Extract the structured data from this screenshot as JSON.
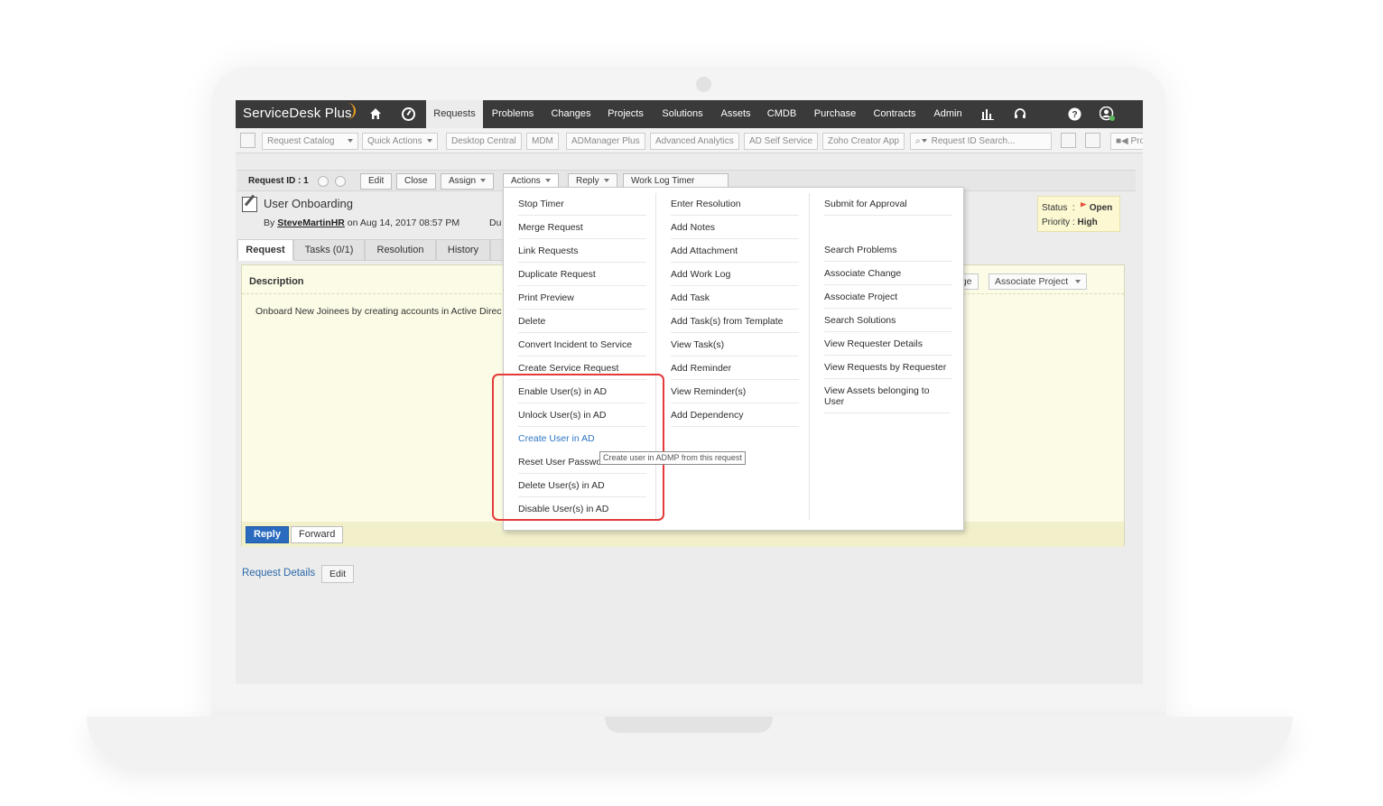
{
  "nav": {
    "logo": "ServiceDesk Plus",
    "tabs": [
      "Requests",
      "Problems",
      "Changes",
      "Projects",
      "Solutions",
      "Assets",
      "CMDB",
      "Purchase",
      "Contracts",
      "Admin"
    ],
    "icons": [
      "home-icon",
      "dashboard-icon",
      "reports-icon",
      "headset-icon",
      "help-icon",
      "user-profile-icon"
    ]
  },
  "toolbar": {
    "request_catalog": "Request Catalog",
    "quick_actions": "Quick Actions",
    "desktop_central": "Desktop Central",
    "mdm": "MDM",
    "admanager": "ADManager Plus",
    "advanced_analytics": "Advanced Analytics",
    "ad_self_service": "AD Self Service",
    "zoho_creator": "Zoho Creator App",
    "search_placeholder": "Request ID Search...",
    "pro": "Pro"
  },
  "request": {
    "id_label": "Request ID : 1",
    "edit": "Edit",
    "close": "Close",
    "assign": "Assign",
    "actions": "Actions",
    "reply": "Reply",
    "worklog_timer": "Work Log Timer",
    "title": "User Onboarding",
    "by": "By",
    "author": "SteveMartinHR",
    "on_date": "on  Aug 14, 2017 08:57 PM",
    "due_partial": "Du",
    "status_label": "Status",
    "status_value": "Open",
    "priority_label": "Priority",
    "priority_value": "High"
  },
  "tabs": [
    "Request",
    "Tasks (0/1)",
    "Resolution",
    "History"
  ],
  "description": {
    "label": "Description",
    "text": "Onboard New Joinees by creating accounts in Active Direc",
    "associate_change_partial": "nge",
    "associate_project": "Associate Project"
  },
  "reply_bar": {
    "reply": "Reply",
    "forward": "Forward"
  },
  "details": {
    "label": "Request Details",
    "edit": "Edit"
  },
  "actions_menu": {
    "col1": [
      "Stop Timer",
      "Merge Request",
      "Link Requests",
      "Duplicate Request",
      "Print Preview",
      "Delete",
      "Convert Incident to Service",
      "Create Service Request",
      "Enable User(s) in AD",
      "Unlock User(s) in AD",
      "Create User in AD",
      "Reset User Passwo",
      "Delete User(s) in AD",
      "Disable User(s) in AD"
    ],
    "col2": [
      "Enter Resolution",
      "Add Notes",
      "Add Attachment",
      "Add Work Log",
      "Add Task",
      "Add Task(s) from Template",
      "View Task(s)",
      "Add Reminder",
      "View Reminder(s)",
      "Add Dependency"
    ],
    "col3": [
      "Submit for Approval",
      "Search Problems",
      "Associate Change",
      "Associate Project",
      "Search Solutions",
      "View Requester Details",
      "View Requests by Requester",
      "View Assets belonging to User"
    ],
    "tooltip": "Create user in ADMP from this request"
  },
  "colors": {
    "nav_bg": "#3a3a3a",
    "highlight": "#e43a3a",
    "link": "#2e76c4",
    "reply_btn": "#2a6bbf"
  }
}
